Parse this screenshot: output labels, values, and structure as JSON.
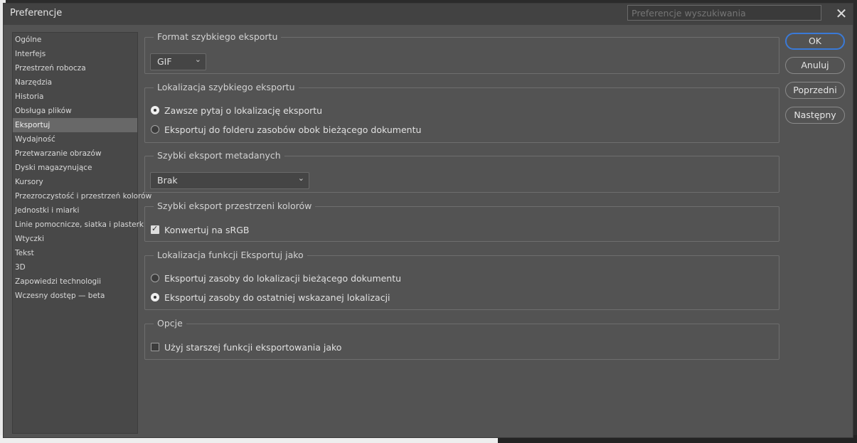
{
  "window": {
    "title": "Preferencje"
  },
  "search": {
    "placeholder": "Preferencje wyszukiwania"
  },
  "sidebar": {
    "items": [
      "Ogólne",
      "Interfejs",
      "Przestrzeń robocza",
      "Narzędzia",
      "Historia",
      "Obsługa plików",
      "Eksportuj",
      "Wydajność",
      "Przetwarzanie obrazów",
      "Dyski magazynujące",
      "Kursory",
      "Przezroczystość i przestrzeń kolorów",
      "Jednostki i miarki",
      "Linie pomocnicze, siatka i plasterki",
      "Wtyczki",
      "Tekst",
      "3D",
      "Zapowiedzi technologii",
      "Wczesny dostęp — beta"
    ],
    "active": "Eksportuj"
  },
  "sections": {
    "format": {
      "title": "Format szybkiego eksportu",
      "value": "GIF"
    },
    "location": {
      "title": "Lokalizacja szybkiego eksportu",
      "option1": "Zawsze pytaj o lokalizację eksportu",
      "option2": "Eksportuj do folderu zasobów obok bieżącego dokumentu",
      "selected": 1
    },
    "metadata": {
      "title": "Szybki eksport metadanych",
      "value": "Brak"
    },
    "colorspace": {
      "title": "Szybki eksport przestrzeni kolorów",
      "checkbox": "Konwertuj na sRGB",
      "checked": true
    },
    "export_as": {
      "title": "Lokalizacja funkcji Eksportuj jako",
      "option1": "Eksportuj zasoby do lokalizacji bieżącego dokumentu",
      "option2": "Eksportuj zasoby do ostatniej wskazanej lokalizacji",
      "selected": 2
    },
    "options": {
      "title": "Opcje",
      "checkbox": "Użyj starszej funkcji eksportowania jako",
      "checked": false
    }
  },
  "buttons": {
    "ok": "OK",
    "cancel": "Anuluj",
    "previous": "Poprzedni",
    "next": "Następny"
  },
  "icons": {
    "close": "close-icon",
    "dropdown": "chevron-down-icon"
  },
  "colors": {
    "dialog_bg": "#535353",
    "sidebar_active": "#686868",
    "focus_ring": "#3a7ad8"
  }
}
